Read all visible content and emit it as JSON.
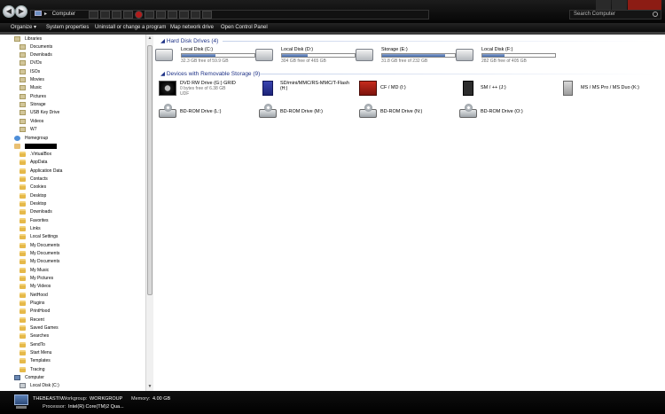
{
  "address": {
    "location": "Computer",
    "chevron": "▸"
  },
  "search": {
    "placeholder": "Search Computer"
  },
  "toolbar": {
    "organize": "Organize ▾",
    "system_properties": "System properties",
    "uninstall": "Uninstall or change a program",
    "map_network": "Map network drive",
    "control_panel": "Open Control Panel"
  },
  "nav": {
    "libraries": "Libraries",
    "library_items": [
      "Documents",
      "Downloads",
      "DVDs",
      "ISOs",
      "Movies",
      "Music",
      "Pictures",
      "Storage",
      "USB Key Drive",
      "Videos",
      "W7"
    ],
    "homegroup": "Homegroup",
    "user_folders": [
      ".VirtualBox",
      "AppData",
      "Application Data",
      "Contacts",
      "Cookies",
      "Desktop",
      "Desktop",
      "Downloads",
      "Favorites",
      "Links",
      "Local Settings",
      "My Documents",
      "My Documents",
      "My Documents",
      "My Music",
      "My Pictures",
      "My Videos",
      "NetHood",
      "Plugins",
      "PrintHood",
      "Recent",
      "Saved Games",
      "Searches",
      "SendTo",
      "Start Menu",
      "Templates",
      "Tracing"
    ],
    "computer": "Computer",
    "computer_children": [
      "Local Disk (C:)"
    ]
  },
  "groups": {
    "hdd_title": "Hard Disk Drives (4)",
    "removable_title": "Devices with Removable Storage (9)"
  },
  "hard_drives": [
    {
      "name": "Local Disk (C:)",
      "free": "32.3 GB free of 59.9 GB",
      "used_fraction": 0.46
    },
    {
      "name": "Local Disk (D:)",
      "free": "304 GB free of 465 GB",
      "used_fraction": 0.35
    },
    {
      "name": "Storage (E:)",
      "free": "31.8 GB free of 232 GB",
      "used_fraction": 0.86
    },
    {
      "name": "Local Disk (F:)",
      "free": "282 GB free of 405 GB",
      "used_fraction": 0.3
    }
  ],
  "removable": {
    "dvd": {
      "name": "DVD RW Drive (G:) GRID",
      "free": "0 bytes free of 6.38 GB",
      "fs": "UDF"
    },
    "sd": {
      "name1": "SD/mini/MMC/RS-MMC/T-Flash",
      "name2": "(H:)"
    },
    "cf": "CF / MD (I:)",
    "sm": "SM / ++ (J:)",
    "ms": "MS / MS Pro / MS Duo (K:)",
    "bd": [
      "BD-ROM Drive (L:)",
      "BD-ROM Drive (M:)",
      "BD-ROM Drive (N:)",
      "BD-ROM Drive (O:)"
    ]
  },
  "details": {
    "computer_name": "THEBEASTIV",
    "workgroup_label": "Workgroup:",
    "workgroup": "WORKGROUP",
    "memory_label": "Memory:",
    "memory": "4.00 GB",
    "processor_label": "Processor:",
    "processor": "Intel(R) Core(TM)2 Qua..."
  }
}
